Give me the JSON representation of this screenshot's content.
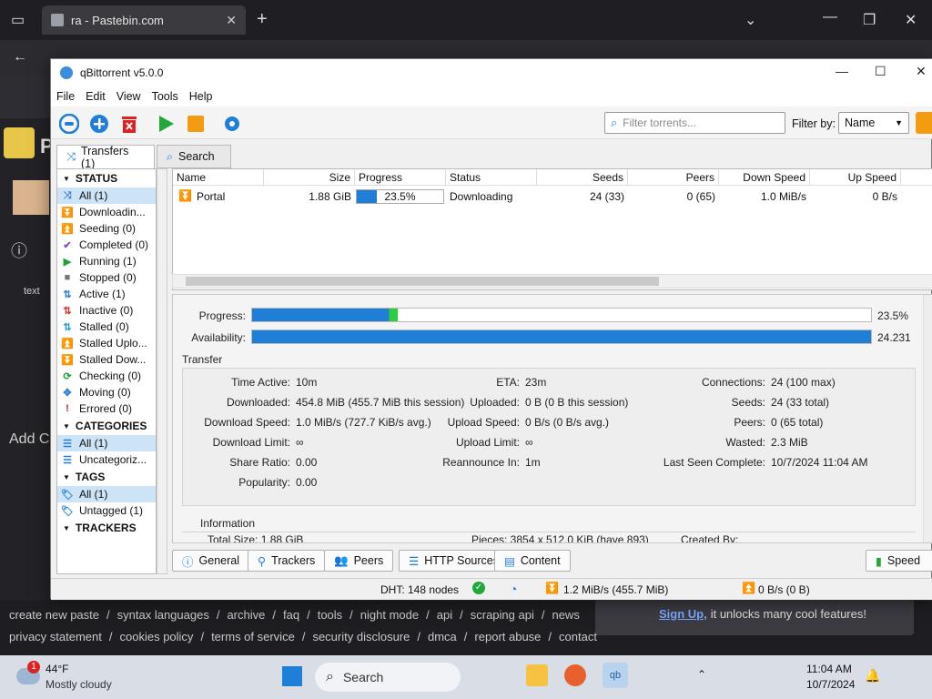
{
  "browser": {
    "tab_title": "ra - Pastebin.com",
    "background_text": "text"
  },
  "background_page": {
    "brand": "P",
    "add_text": "Add C",
    "footer_links_row1": [
      "create new paste",
      "syntax languages",
      "archive",
      "faq",
      "tools",
      "night mode",
      "api",
      "scraping api",
      "news"
    ],
    "footer_links_row2": [
      "privacy statement",
      "cookies policy",
      "terms of service",
      "security disclosure",
      "dmca",
      "report abuse",
      "contact"
    ],
    "signup_link": "Sign Up,",
    "signup_text": "it unlocks many cool features!"
  },
  "qb": {
    "title": "qBittorrent v5.0.0",
    "menu": [
      "File",
      "Edit",
      "View",
      "Tools",
      "Help"
    ],
    "filter_placeholder": "Filter torrents...",
    "filter_by_label": "Filter by:",
    "filter_by_value": "Name",
    "side_tabs": {
      "transfers": "Transfers (1)",
      "search": "Search"
    },
    "status_header": "STATUS",
    "status_items": [
      {
        "label": "All (1)",
        "icon": "all-icon",
        "color": "#3b7dd8",
        "glyph": "⤨"
      },
      {
        "label": "Downloadin...",
        "icon": "downloading-icon",
        "color": "#1e9e3e",
        "glyph": "⏬"
      },
      {
        "label": "Seeding (0)",
        "icon": "seeding-icon",
        "color": "#3b7dd8",
        "glyph": "⏫"
      },
      {
        "label": "Completed (0)",
        "icon": "completed-icon",
        "color": "#7b4bc9",
        "glyph": "✔"
      },
      {
        "label": "Running (1)",
        "icon": "running-icon",
        "color": "#1e9e3e",
        "glyph": "▶"
      },
      {
        "label": "Stopped (0)",
        "icon": "stopped-icon",
        "color": "#777777",
        "glyph": "■"
      },
      {
        "label": "Active (1)",
        "icon": "active-icon",
        "color": "#2a7fd6",
        "glyph": "⇅"
      },
      {
        "label": "Inactive (0)",
        "icon": "inactive-icon",
        "color": "#d33333",
        "glyph": "⇅"
      },
      {
        "label": "Stalled (0)",
        "icon": "stalled-icon",
        "color": "#2a9fd6",
        "glyph": "⇅"
      },
      {
        "label": "Stalled Uplo...",
        "icon": "stalled-upload-icon",
        "color": "#3b7dd8",
        "glyph": "⏫"
      },
      {
        "label": "Stalled Dow...",
        "icon": "stalled-download-icon",
        "color": "#1e9e3e",
        "glyph": "⏬"
      },
      {
        "label": "Checking (0)",
        "icon": "checking-icon",
        "color": "#1e9e3e",
        "glyph": "⟳"
      },
      {
        "label": "Moving (0)",
        "icon": "moving-icon",
        "color": "#2a7fd6",
        "glyph": "✥"
      },
      {
        "label": "Errored (0)",
        "icon": "errored-icon",
        "color": "#d01f1f",
        "glyph": "!"
      }
    ],
    "categories_header": "CATEGORIES",
    "category_items": [
      {
        "label": "All (1)"
      },
      {
        "label": "Uncategoriz..."
      }
    ],
    "tags_header": "TAGS",
    "tag_items": [
      {
        "label": "All (1)"
      },
      {
        "label": "Untagged (1)"
      }
    ],
    "trackers_header": "TRACKERS",
    "columns": [
      "Name",
      "Size",
      "Progress",
      "Status",
      "Seeds",
      "Peers",
      "Down Speed",
      "Up Speed"
    ],
    "torrent": {
      "name": "Portal",
      "size": "1.88 GiB",
      "progress_text": "23.5%",
      "progress_fraction": 0.235,
      "status": "Downloading",
      "seeds": "24 (33)",
      "peers": "0 (65)",
      "down_speed": "1.0 MiB/s",
      "up_speed": "0 B/s"
    },
    "details": {
      "progress_label": "Progress:",
      "progress_value": "23.5%",
      "availability_label": "Availability:",
      "availability_value": "24.231",
      "transfer_header": "Transfer",
      "transfer_rows": [
        [
          [
            "Time Active:",
            "10m"
          ],
          [
            "ETA:",
            "23m"
          ],
          [
            "Connections:",
            "24 (100 max)"
          ]
        ],
        [
          [
            "Downloaded:",
            "454.8 MiB (455.7 MiB this session)"
          ],
          [
            "Uploaded:",
            "0 B (0 B this session)"
          ],
          [
            "Seeds:",
            "24 (33 total)"
          ]
        ],
        [
          [
            "Download Speed:",
            "1.0 MiB/s (727.7 KiB/s avg.)"
          ],
          [
            "Upload Speed:",
            "0 B/s (0 B/s avg.)"
          ],
          [
            "Peers:",
            "0 (65 total)"
          ]
        ],
        [
          [
            "Download Limit:",
            "∞"
          ],
          [
            "Upload Limit:",
            "∞"
          ],
          [
            "Wasted:",
            "2.3 MiB"
          ]
        ],
        [
          [
            "Share Ratio:",
            "0.00"
          ],
          [
            "Reannounce In:",
            "1m"
          ],
          [
            "Last Seen Complete:",
            "10/7/2024 11:04 AM"
          ]
        ],
        [
          [
            "Popularity:",
            "0.00"
          ],
          [
            "",
            ""
          ],
          [
            "",
            ""
          ]
        ]
      ],
      "information_header": "Information",
      "info_partial": [
        "Total Size: 1.88 GiB",
        "Pieces: 3854 x 512.0 KiB (have 893)",
        "Created By:"
      ]
    },
    "bottom_tabs": [
      "General",
      "Trackers",
      "Peers",
      "HTTP Sources",
      "Content"
    ],
    "speed_button": "Speed",
    "status_bar": {
      "dht": "DHT: 148 nodes",
      "down": "1.2 MiB/s (455.7 MiB)",
      "up": "0 B/s (0 B)"
    }
  },
  "taskbar": {
    "weather_badge": "1",
    "weather_temp": "44°F",
    "weather_desc": "Mostly cloudy",
    "search_placeholder": "Search",
    "time": "11:04 AM",
    "date": "10/7/2024"
  },
  "colors": {
    "accent_blue": "#1f7fd6",
    "progress_green": "#2ecc40"
  }
}
